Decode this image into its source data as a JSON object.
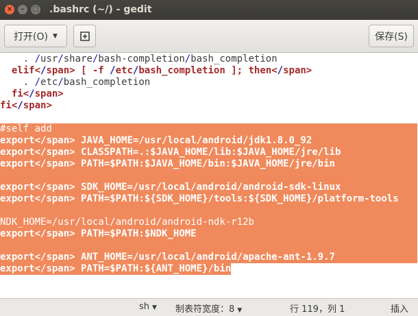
{
  "window": {
    "title": ".bashrc (~/) - gedit"
  },
  "header": {
    "open_label": "打开(O)",
    "save_label": "保存(S)"
  },
  "editor": {
    "lines": [
      "    . /usr/share/bash-completion/bash_completion",
      "  elif [ -f /etc/bash_completion ]; then",
      "    . /etc/bash_completion",
      "  fi",
      "fi",
      "",
      "#self add",
      "export JAVA_HOME=/usr/local/android/jdk1.8.0_92",
      "export CLASSPATH=.:$JAVA_HOME/lib:$JAVA_HOME/jre/lib",
      "export PATH=$PATH:$JAVA_HOME/bin:$JAVA_HOME/jre/bin",
      "",
      "export SDK_HOME=/usr/local/android/android-sdk-linux",
      "export PATH=$PATH:${SDK_HOME}/tools:${SDK_HOME}/platform-tools",
      "",
      "NDK_HOME=/usr/local/android/android-ndk-r12b",
      "export PATH=$PATH:$NDK_HOME",
      "",
      "export ANT_HOME=/usr/local/android/apache-ant-1.9.7",
      "export PATH=$PATH:${ANT_HOME}/bin"
    ],
    "selection_color": "#f0895b"
  },
  "status": {
    "language": "sh",
    "tab_width_label": "制表符宽度：",
    "tab_width_value": "8",
    "position": "行 119，列 1",
    "insert_mode": "插入"
  }
}
